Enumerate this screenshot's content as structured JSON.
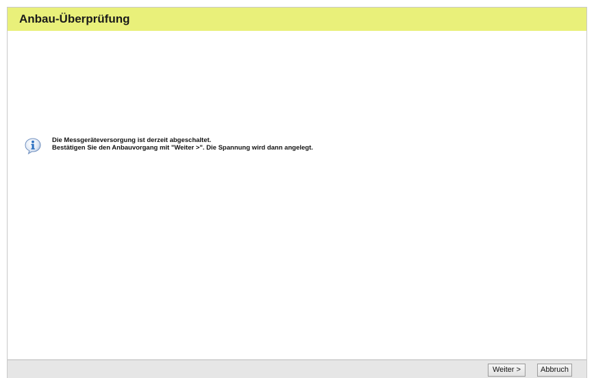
{
  "header": {
    "title": "Anbau-Überprüfung"
  },
  "message": {
    "icon": "info-icon",
    "line1": "Die Messgeräteversorgung ist derzeit abgeschaltet.",
    "line2": "Bestätigen Sie den Anbauvorgang mit \"Weiter >\". Die Spannung wird dann angelegt."
  },
  "footer": {
    "next_label": "Weiter >",
    "cancel_label": "Abbruch"
  },
  "colors": {
    "header_background": "#e9f07a",
    "footer_background": "#e6e6e6",
    "info_icon_blue": "#2a6fc0"
  }
}
